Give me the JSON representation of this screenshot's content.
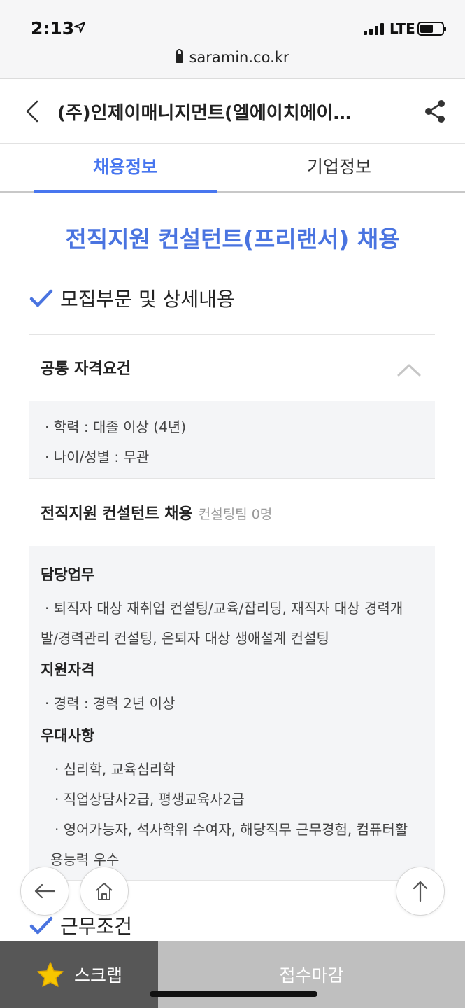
{
  "status": {
    "time": "2:13",
    "network": "LTE"
  },
  "browser": {
    "url": "saramin.co.kr"
  },
  "header": {
    "company": "(주)인제이매니지먼트(엘에이치에이…"
  },
  "tabs": [
    {
      "label": "채용정보",
      "active": true
    },
    {
      "label": "기업정보",
      "active": false
    }
  ],
  "job_title": "전직지원 컨설턴트(프리랜서) 채용",
  "sections": {
    "recruit": "모집부문 및 상세내용",
    "work": "근무조건"
  },
  "common_requirements": {
    "title": "공통 자격요건",
    "items": [
      "· 학력 : 대졸 이상 (4년)",
      "· 나이/성별 : 무관"
    ]
  },
  "position": {
    "title": "전직지원 컨설턴트 채용",
    "team": "컨설팅팀 0명",
    "duties_head": "담당업무",
    "duties": [
      "· 퇴직자 대상 재취업 컨설팅/교육/잡리딩, 재직자 대상 경력개",
      "발/경력관리 컨설팅, 은퇴자 대상 생애설계 컨설팅"
    ],
    "qual_head": "지원자격",
    "qual": [
      "· 경력 : 경력 2년 이상"
    ],
    "pref_head": "우대사항",
    "pref": [
      "· 심리학, 교육심리학",
      "· 직업상담사2급, 평생교육사2급",
      "· 영어가능자, 석사학위 수여자, 해당직무 근무경험, 컴퓨터활",
      "용능력 우수"
    ]
  },
  "bottom": {
    "scrap": "스크랩",
    "closed": "접수마감"
  },
  "colors": {
    "accent": "#4876ef",
    "scrap_bg": "#575757",
    "closed_bg": "#bfbfbf"
  }
}
